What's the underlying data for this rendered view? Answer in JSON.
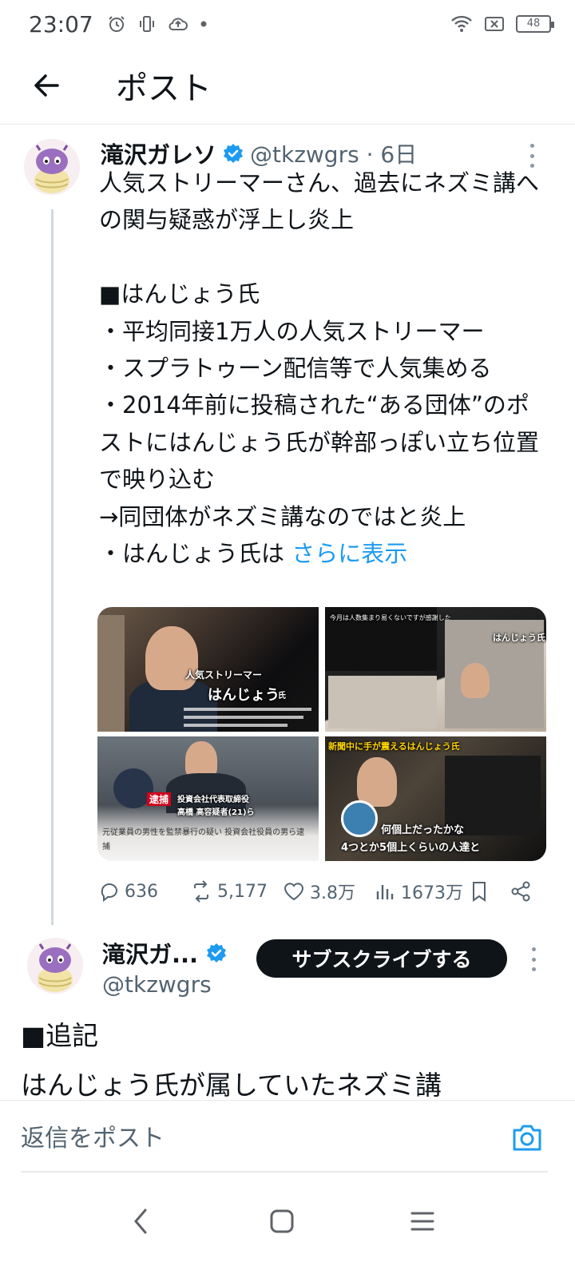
{
  "status_bar": {
    "time": "23:07",
    "battery": "48"
  },
  "header": {
    "title": "ポスト"
  },
  "post1": {
    "display_name": "滝沢ガレソ",
    "handle_time": "@tkzwgrs · 6日",
    "body": "人気ストリーマーさん、過去にネズミ講への関与疑惑が浮上し炎上\n\n■はんじょう氏\n・平均同接1万人の人気ストリーマー\n・スプラトゥーン配信等で人気集める\n・2014年前に投稿された“ある団体”のポストにはんじょう氏が幹部っぽい立ち位置で映り込む\n→同団体がネズミ講なのではと炎上\n・はんじょう氏は ",
    "show_more": "さらに表示",
    "images": [
      {
        "caption_1": "人気ストリーマー",
        "caption_2": "はんじょう",
        "caption_3": "氏"
      },
      {
        "caption_1": "今月は人数集まり易くないですが感謝した",
        "caption_2": "はんじょう氏"
      },
      {
        "caption_1": "逮捕",
        "caption_2": "投資会社代表取締役",
        "caption_3": "高橋 高容疑者(21)ら",
        "caption_4": "元従業員の男性を監禁暴行の疑い 投資会社役員の男ら逮捕"
      },
      {
        "caption_1": "新聞中に手が震えるはんじょう氏",
        "caption_2": "何個上だったかな",
        "caption_3": "4つとか5個上くらいの人達と"
      }
    ],
    "replies": "636",
    "reposts": "5,177",
    "likes": "3.8万",
    "views": "1673万"
  },
  "post2": {
    "display_name": "滝沢ガ...",
    "handle": "@tkzwgrs",
    "subscribe_label": "サブスクライブする",
    "body": "■追記\nはんじょう氏が属していたネズミ講"
  },
  "reply_bar": {
    "placeholder": "返信をポスト"
  },
  "colors": {
    "accent": "#1d9bf0",
    "text": "#0f1419",
    "secondary": "#536471"
  }
}
